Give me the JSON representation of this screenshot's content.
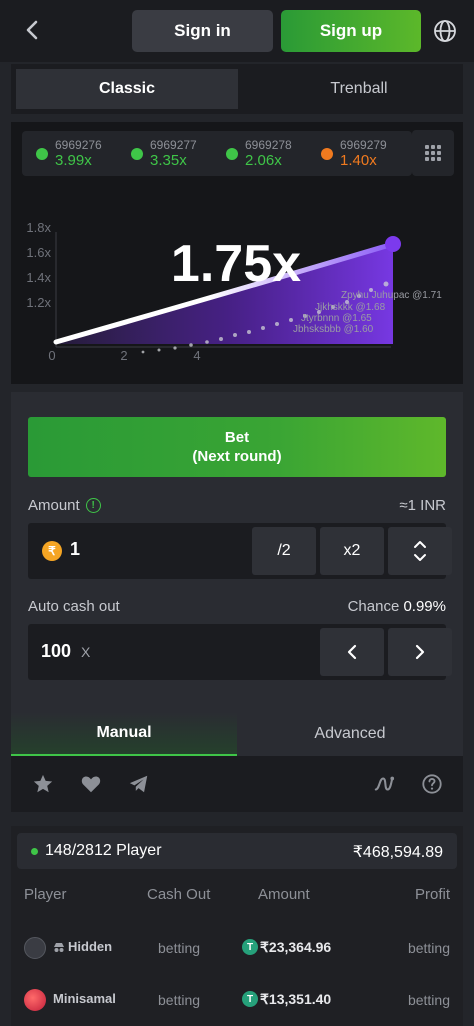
{
  "header": {
    "sign_in": "Sign in",
    "sign_up": "Sign up"
  },
  "modes": [
    "Classic",
    "Trenball"
  ],
  "history": [
    {
      "id": "6969276",
      "value": "3.99x",
      "color": "#3fc548"
    },
    {
      "id": "6969277",
      "value": "3.35x",
      "color": "#3fc548"
    },
    {
      "id": "6969278",
      "value": "2.06x",
      "color": "#3fc548"
    },
    {
      "id": "6969279",
      "value": "1.40x",
      "color": "#f07a1f"
    }
  ],
  "game": {
    "multiplier": "1.75x",
    "y_ticks": [
      "1.8x",
      "1.6x",
      "1.4x",
      "1.2x"
    ],
    "x_ticks": [
      "0",
      "2",
      "4"
    ],
    "cashout_labels": [
      "Zpyhu Juhupac @1.71",
      "Jjkhskkk @1.68",
      "Jtyrbnnn @1.65",
      "Jbhsksbbb @1.60"
    ]
  },
  "bet": {
    "button_line1": "Bet",
    "button_line2": "(Next round)",
    "amount_label": "Amount",
    "inr_value": "≈1 INR",
    "amount_value": "1",
    "half_label": "/2",
    "double_label": "x2",
    "auto_cashout_label": "Auto cash out",
    "chance_label": "Chance",
    "chance_value": "0.99%",
    "auto_value": "100",
    "auto_unit": "X"
  },
  "tabs": [
    "Manual",
    "Advanced"
  ],
  "players": {
    "online": "148/2812 Player",
    "total": "₹468,594.89",
    "columns": [
      "Player",
      "Cash Out",
      "Amount",
      "Profit"
    ],
    "rows": [
      {
        "name": "Hidden",
        "cashout": "betting",
        "amount": "₹23,364.96",
        "profit": "betting"
      },
      {
        "name": "Minisamal",
        "cashout": "betting",
        "amount": "₹13,351.40",
        "profit": "betting"
      }
    ]
  },
  "colors": {
    "accent_green": "#3fc548",
    "accent_orange": "#f07a1f",
    "curve_purple": "#7c3aed"
  }
}
